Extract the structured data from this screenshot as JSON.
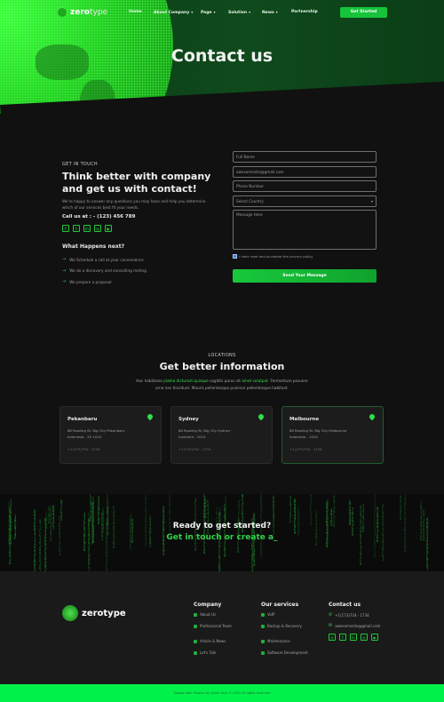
{
  "nav": {
    "brand_bold": "zero",
    "brand_light": "type",
    "items": [
      {
        "label": "Home",
        "has_dropdown": false
      },
      {
        "label": "About Company",
        "has_dropdown": true
      },
      {
        "label": "Page",
        "has_dropdown": true
      },
      {
        "label": "Solution",
        "has_dropdown": true
      },
      {
        "label": "News",
        "has_dropdown": true
      },
      {
        "label": "Partnership",
        "has_dropdown": false
      }
    ],
    "cta_label": "Get Started"
  },
  "hero": {
    "title": "Contact us"
  },
  "contact": {
    "eyebrow": "GET IN TOUCH",
    "heading": "Think better with company and get us with contact!",
    "intro": "We're happy to answer any questions you may have and help you determine which of our services best fit your needs.",
    "call": "Call us at : - (123) 456 789",
    "socials": [
      {
        "icon": "facebook-icon",
        "glyph": "f"
      },
      {
        "icon": "twitter-icon",
        "glyph": "t"
      },
      {
        "icon": "linkedin-icon",
        "glyph": "in"
      },
      {
        "icon": "dribbble-icon",
        "glyph": "◎"
      },
      {
        "icon": "youtube-icon",
        "glyph": "▶"
      }
    ],
    "next_title": "What Happens next?",
    "next_steps": [
      "We Schedule a call at your convenience",
      "We do a discovery and consulting meting",
      "We prepare a proposal"
    ]
  },
  "form": {
    "full_name_placeholder": "Full Name",
    "email_value": "awesomesite@gmail.com",
    "phone_placeholder": "Phone Number",
    "country_selected": "Select Country",
    "message_placeholder": "Message Here",
    "consent_label": "I have read and accepted the privacy policy",
    "consent_checked": true,
    "submit_label": "Send Your Message"
  },
  "locations": {
    "eyebrow": "LOCATIONS",
    "heading": "Get better information",
    "desc_1": "Hac habitasse ",
    "desc_hl_1": "platea dictumst quisque",
    "desc_2": " sagittis purus sit ",
    "desc_hl_2": "amet volutpat",
    "desc_3": ". Fermentum posuere urna nec tincidunt. Mauris pellentesque pulvinar pellentesque habitant.",
    "cards": [
      {
        "city": "Pekanbaru",
        "address_line1": "88 Rowling St. Big City Pekanbaru",
        "address_line2": "Indonesia - 2X 1024",
        "phone": "+1(173)734 - 1734"
      },
      {
        "city": "Sydney",
        "address_line1": "88 Rowling St. Big City Sydney",
        "address_line2": "Australia - 1024",
        "phone": "+1(173)734 - 1734"
      },
      {
        "city": "Melbourne",
        "address_line1": "88 Rowling St. Big City Melbourne",
        "address_line2": "Indonesia - 1024",
        "phone": "+1(173)734 - 1734"
      }
    ]
  },
  "cta": {
    "title": "Ready to get started?",
    "subtitle": "Get in touch or create a_"
  },
  "footer": {
    "brand": "zerotype",
    "columns": [
      {
        "title": "Company",
        "links": [
          "About Us",
          "Professional Team",
          "Article & News",
          "Let's Talk"
        ]
      },
      {
        "title": "Our services",
        "links": [
          "VoIP",
          "Backup & Recovery",
          "Maintenance",
          "Software Development"
        ]
      }
    ],
    "contact_title": "Contact us",
    "phone": "+1(173)734 - 1734",
    "email": "awesomesite@gmail.com",
    "socials": [
      {
        "icon": "dribbble-icon",
        "glyph": "◎"
      },
      {
        "icon": "twitter-icon",
        "glyph": "t"
      },
      {
        "icon": "linkedin-icon",
        "glyph": "in"
      },
      {
        "icon": "dribbble-icon",
        "glyph": "◎"
      },
      {
        "icon": "youtube-icon",
        "glyph": "▶"
      }
    ],
    "copyright": "Design with Passion by Zeroo Tech © 2023 All rights reserved"
  },
  "colors": {
    "accent": "#16c43b",
    "bottom_bar": "#00f24a",
    "background": "#111111"
  }
}
